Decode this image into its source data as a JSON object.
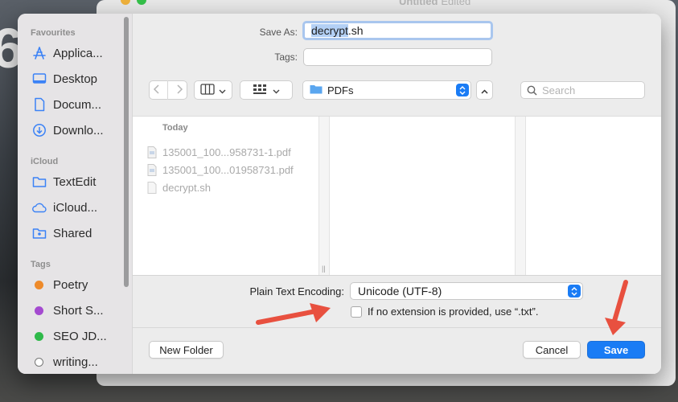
{
  "background_window": {
    "title": "Untitled",
    "status": "Edited"
  },
  "sidebar": {
    "sections": {
      "favourites": "Favourites",
      "icloud": "iCloud",
      "tags": "Tags"
    },
    "favourites": [
      {
        "label": "Applica...",
        "icon": "applications-icon"
      },
      {
        "label": "Desktop",
        "icon": "desktop-icon"
      },
      {
        "label": "Docum...",
        "icon": "document-icon"
      },
      {
        "label": "Downlo...",
        "icon": "download-icon"
      }
    ],
    "icloud": [
      {
        "label": "TextEdit",
        "icon": "folder-icon"
      },
      {
        "label": "iCloud...",
        "icon": "cloud-icon"
      },
      {
        "label": "Shared",
        "icon": "shared-folder-icon"
      }
    ],
    "tags": [
      {
        "label": "Poetry",
        "color": "#ee8a2a"
      },
      {
        "label": "Short S...",
        "color": "#a44ad0"
      },
      {
        "label": "SEO JD...",
        "color": "#2fb94a"
      },
      {
        "label": "writing...",
        "color": "#ffffff"
      }
    ]
  },
  "save_as": {
    "label": "Save As:",
    "value_selected": "decrypt",
    "value_ext": ".sh"
  },
  "tags_field": {
    "label": "Tags:",
    "value": ""
  },
  "toolbar": {
    "location": "PDFs",
    "search_placeholder": "Search"
  },
  "browser": {
    "group_header": "Today",
    "files": [
      {
        "name": "135001_100...958731-1.pdf",
        "icon": "pdf-file-icon"
      },
      {
        "name": "135001_100...01958731.pdf",
        "icon": "pdf-file-icon"
      },
      {
        "name": "decrypt.sh",
        "icon": "file-icon"
      }
    ]
  },
  "options": {
    "encoding_label": "Plain Text Encoding:",
    "encoding_value": "Unicode (UTF-8)",
    "extension_checkbox_label": "If no extension is provided, use “.txt”.",
    "extension_checkbox_checked": false
  },
  "buttons": {
    "new_folder": "New Folder",
    "cancel": "Cancel",
    "save": "Save"
  },
  "colors": {
    "accent": "#1a7cf5",
    "annotation_arrow": "#e8503f"
  }
}
